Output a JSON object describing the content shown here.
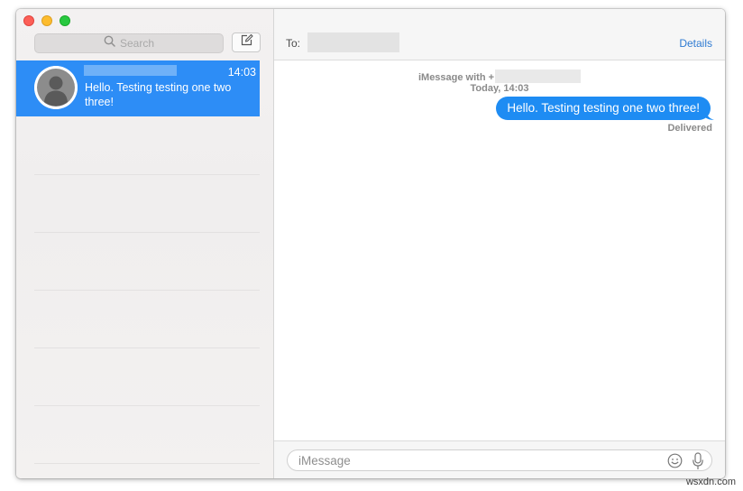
{
  "window": {
    "controls": [
      "close",
      "minimize",
      "maximize"
    ]
  },
  "sidebar": {
    "search": {
      "placeholder": "Search",
      "icon": "search-icon"
    },
    "compose_icon": "compose-icon",
    "conversations": [
      {
        "time": "14:03",
        "preview": "Hello. Testing testing one two three!",
        "avatar_icon": "person-silhouette-icon",
        "selected": true
      }
    ]
  },
  "header": {
    "to_label": "To:",
    "details_label": "Details"
  },
  "thread": {
    "service_label": "iMessage with +",
    "timestamp": "Today, 14:03",
    "messages": [
      {
        "text": "Hello. Testing testing one two three!",
        "outgoing": true,
        "status": "Delivered"
      }
    ]
  },
  "composer": {
    "placeholder": "iMessage",
    "emoji_icon": "emoji-icon",
    "mic_icon": "microphone-icon"
  },
  "watermark": "wsxdn.com",
  "colors": {
    "selection": "#2d8df6",
    "bubble": "#1e8cf3",
    "link": "#2f7bd2"
  }
}
